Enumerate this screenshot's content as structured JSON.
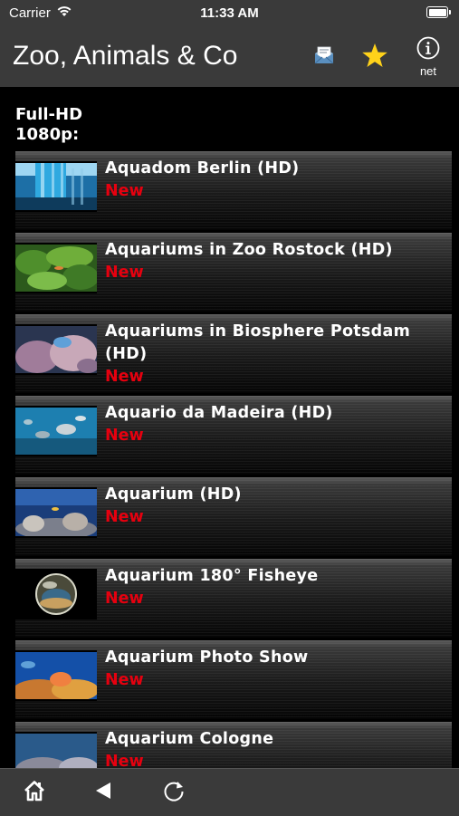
{
  "status_bar": {
    "carrier": "Carrier",
    "time": "11:33 AM"
  },
  "nav": {
    "title": "Zoo, Animals & Co",
    "info_label": "net",
    "icons": [
      "mail-icon",
      "star-icon",
      "info-icon"
    ]
  },
  "section": {
    "title": "Full-HD\n1080p:"
  },
  "list": {
    "items": [
      {
        "title": "Aquadom Berlin (HD)",
        "badge": "New"
      },
      {
        "title": "Aquariums in Zoo Rostock (HD)",
        "badge": "New"
      },
      {
        "title": "Aquariums in Biosphere Potsdam (HD)",
        "badge": "New"
      },
      {
        "title": "Aquario da Madeira (HD)",
        "badge": "New"
      },
      {
        "title": "Aquarium (HD)",
        "badge": "New"
      },
      {
        "title": "Aquarium 180° Fisheye",
        "badge": "New"
      },
      {
        "title": "Aquarium Photo Show",
        "badge": "New"
      },
      {
        "title": "Aquarium Cologne",
        "badge": "New"
      }
    ]
  },
  "tab_bar": {
    "icons": [
      "home-icon",
      "back-icon",
      "reload-icon"
    ]
  },
  "colors": {
    "bar": "#3a3a3a",
    "badge": "#e6000f",
    "star": "#ffd21a",
    "background": "#000000"
  }
}
